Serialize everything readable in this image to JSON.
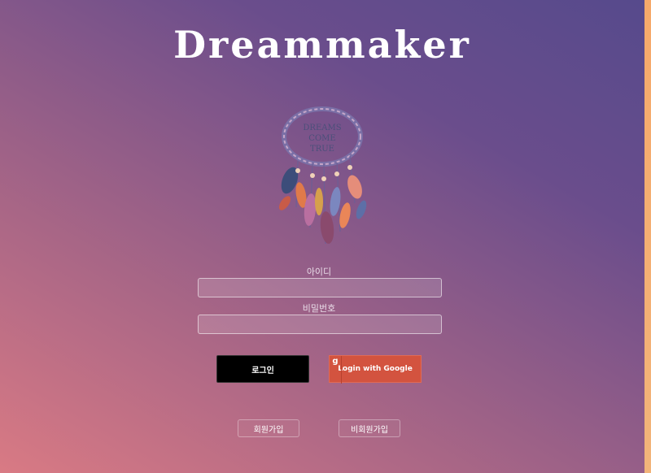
{
  "app": {
    "title": "Dreammaker"
  },
  "logo": {
    "text_lines": [
      "DREAMS",
      "COME",
      "TRUE"
    ]
  },
  "form": {
    "id_label": "아이디",
    "password_label": "비밀번호",
    "id_value": "",
    "password_value": ""
  },
  "buttons": {
    "login": "로그인",
    "google": "Login with Google",
    "google_icon": "g",
    "signup": "회원가입",
    "guest_signup": "비회원가입"
  },
  "colors": {
    "background_start": "#d97a84",
    "background_end": "#564a8c",
    "google_button": "#d3533f",
    "login_button": "#000000"
  }
}
